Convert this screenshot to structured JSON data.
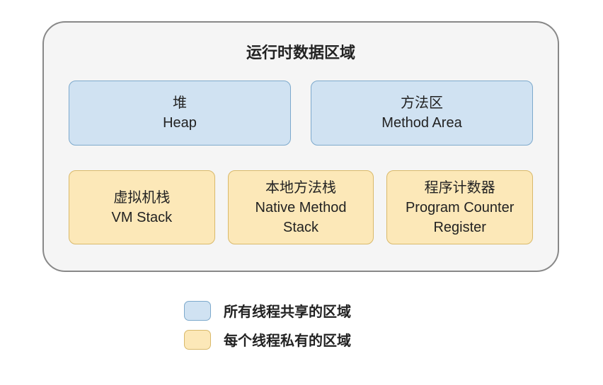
{
  "title": "运行时数据区域",
  "sharedBoxes": [
    {
      "cn": "堆",
      "en": "Heap"
    },
    {
      "cn": "方法区",
      "en": "Method Area"
    }
  ],
  "privateBoxes": [
    {
      "cn": "虚拟机栈",
      "en": "VM Stack"
    },
    {
      "cn": "本地方法栈",
      "en1": "Native Method",
      "en2": "Stack"
    },
    {
      "cn": "程序计数器",
      "en1": "Program Counter",
      "en2": "Register"
    }
  ],
  "legend": {
    "shared": "所有线程共享的区域",
    "private": "每个线程私有的区域"
  },
  "colors": {
    "sharedFill": "#d0e2f2",
    "sharedBorder": "#7da9cc",
    "privateFill": "#fce8b8",
    "privateBorder": "#d9b96a"
  }
}
